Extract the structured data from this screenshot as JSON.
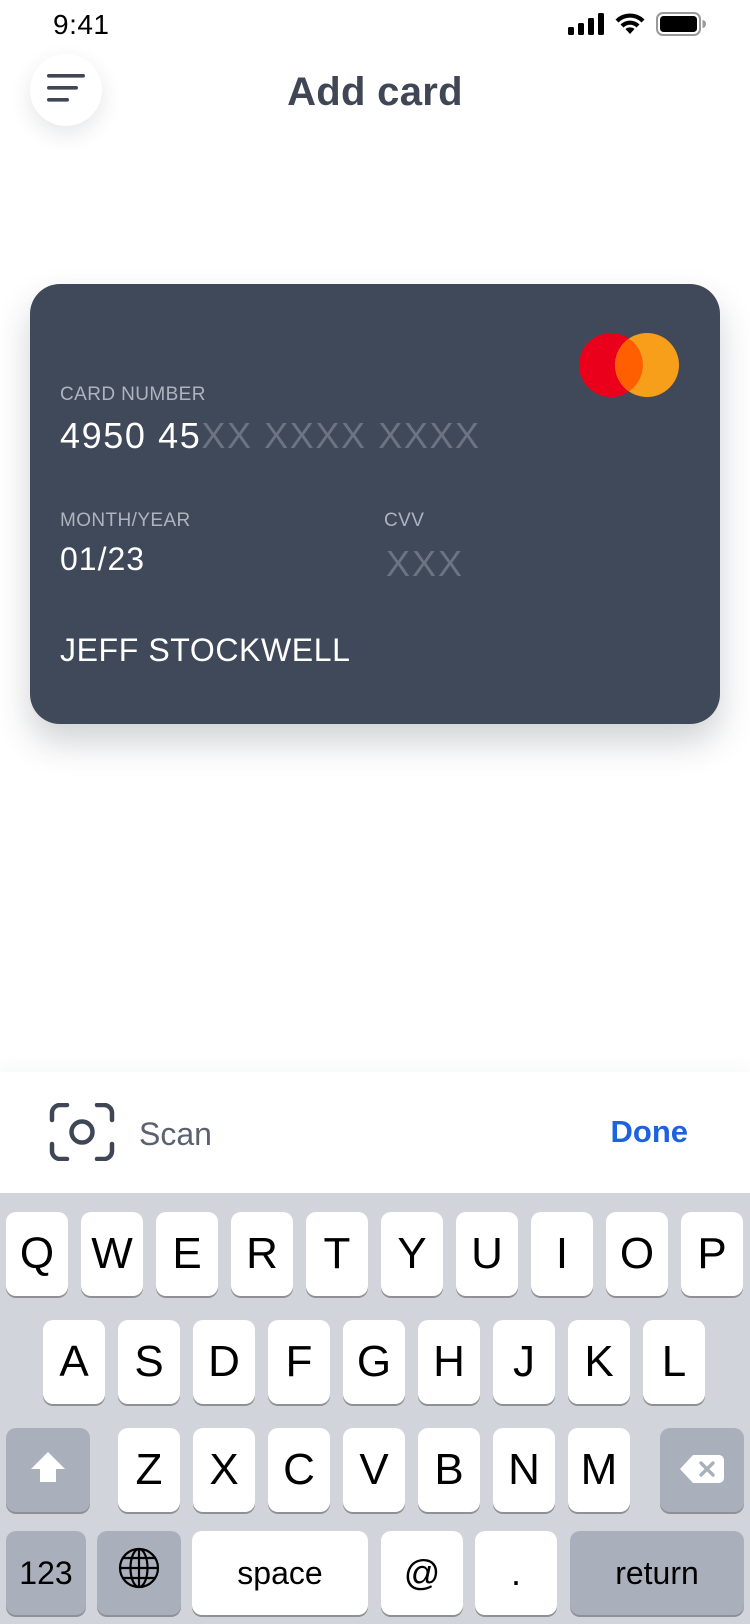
{
  "status_bar": {
    "time": "9:41",
    "icons": [
      "cellular-signal-icon",
      "wifi-icon",
      "battery-icon"
    ]
  },
  "header": {
    "menu_icon": "hamburger-menu-icon",
    "title": "Add card"
  },
  "card": {
    "brand_icon": "mastercard-logo-icon",
    "number_label": "CARD NUMBER",
    "number_entered": "4950 45",
    "number_placeholder": "XX XXXX XXXX",
    "expiry_label": "MONTH/YEAR",
    "expiry_value": "01/23",
    "cvv_label": "CVV",
    "cvv_placeholder": "XXX",
    "cardholder_name": "JEFF STOCKWELL",
    "colors": {
      "background": "#404959",
      "mastercard_red": "#eb001b",
      "mastercard_orange": "#f79e1b"
    }
  },
  "accessory_bar": {
    "scan_icon": "scan-camera-icon",
    "scan_label": "Scan",
    "done_label": "Done",
    "accent_color": "#1d63e0"
  },
  "keyboard": {
    "row1": [
      "Q",
      "W",
      "E",
      "R",
      "T",
      "Y",
      "U",
      "I",
      "O",
      "P"
    ],
    "row2": [
      "A",
      "S",
      "D",
      "F",
      "G",
      "H",
      "J",
      "K",
      "L"
    ],
    "row3": [
      "Z",
      "X",
      "C",
      "V",
      "B",
      "N",
      "M"
    ],
    "shift_icon": "shift-arrow-icon",
    "backspace_icon": "backspace-icon",
    "globe_icon": "globe-icon",
    "numbers_label": "123",
    "space_label": "space",
    "at_label": "@",
    "dot_label": ".",
    "return_label": "return"
  }
}
